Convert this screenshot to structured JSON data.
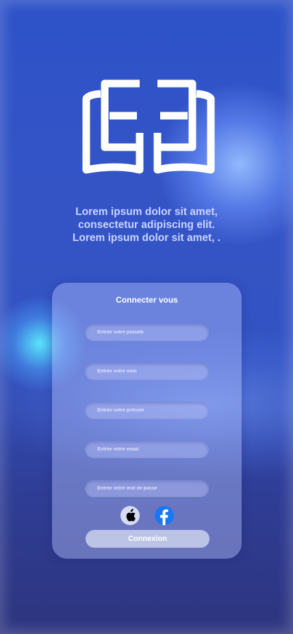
{
  "tagline": {
    "line1": "Lorem ipsum dolor sit amet,",
    "line2": "consectetur adipiscing elit.",
    "line3": "Lorem ipsum dolor sit amet, ."
  },
  "form": {
    "title": "Connecter vous",
    "fields": [
      {
        "placeholder": "Entrée votre pseudo"
      },
      {
        "placeholder": "Entrée votre nom"
      },
      {
        "placeholder": "Entrée votre prénom"
      },
      {
        "placeholder": "Entrée votre email"
      },
      {
        "placeholder": "Entrée votre mot de passe"
      }
    ],
    "social": {
      "apple": "apple-icon",
      "facebook": "facebook-icon"
    },
    "submit_label": "Connexion"
  },
  "colors": {
    "background": "#2f4ec2",
    "facebook": "#1877f2",
    "card": "#b9c6ff",
    "button": "#bcc4e6"
  }
}
